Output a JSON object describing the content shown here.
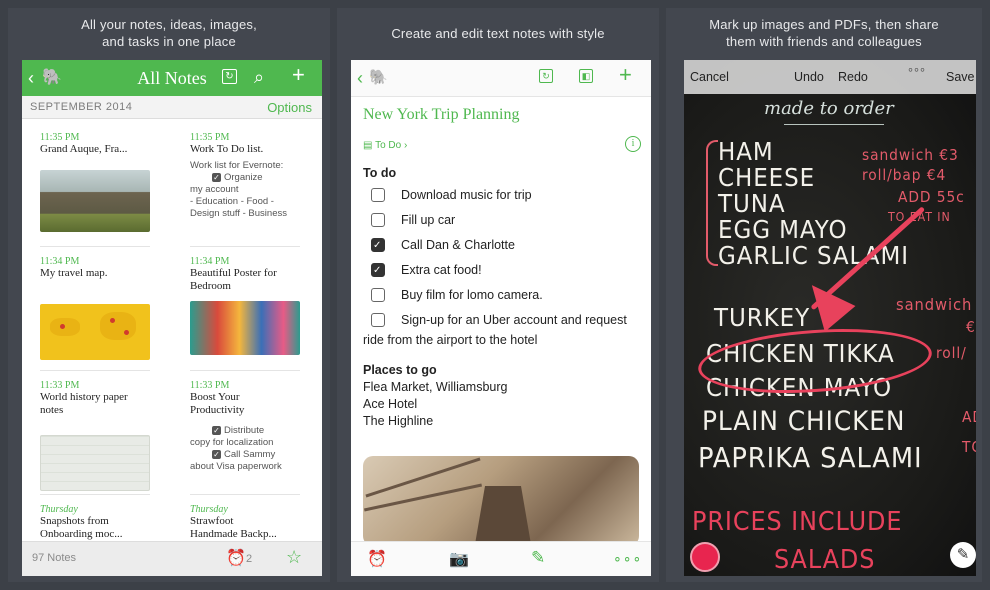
{
  "captions": {
    "p1": "All your notes, ideas, images,\nand tasks in one place",
    "p2": "Create and edit text notes with style",
    "p3": "Mark up images and PDFs, then share\nthem with friends and colleagues"
  },
  "panel1": {
    "title": "All Notes",
    "month": "SEPTEMBER 2014",
    "options": "Options",
    "count": "97 Notes",
    "reminder_count": "2",
    "notes": [
      {
        "time": "11:35 PM",
        "title": "Grand Auque, Fra..."
      },
      {
        "time": "11:35 PM",
        "title": "Work To Do list.",
        "text1": "Work list for Evernote:",
        "text2": "Organize",
        "text3": "my account",
        "text4": "- Education - Food -",
        "text5": "Design stuff - Business"
      },
      {
        "time": "11:34 PM",
        "title": "My travel map."
      },
      {
        "time": "11:34 PM",
        "title": "Beautiful  Poster for",
        "title2": "Bedroom"
      },
      {
        "time": "11:33 PM",
        "title": "World history paper",
        "title2": "notes"
      },
      {
        "time": "11:33 PM",
        "title": "Boost Your",
        "title2": "Productivity",
        "text1": "Distribute",
        "text2": "copy for localization",
        "text3": "Call Sammy",
        "text4": "about Visa paperwork"
      },
      {
        "time": "Thursday",
        "title": "Snapshots from",
        "title2": "Onboarding moc..."
      },
      {
        "time": "Thursday",
        "title": "Strawfoot",
        "title2": "Handmade Backp..."
      }
    ]
  },
  "panel2": {
    "note_title": "New York Trip Planning",
    "tag": "To Do",
    "todo_heading": "To do",
    "todos": [
      {
        "label": "Download music for trip",
        "done": false
      },
      {
        "label": "Fill up car",
        "done": false
      },
      {
        "label": "Call Dan & Charlotte",
        "done": true
      },
      {
        "label": "Extra cat food!",
        "done": true
      },
      {
        "label": "Buy film for lomo camera.",
        "done": false
      },
      {
        "label": "Sign-up for an Uber account and request",
        "done": false
      }
    ],
    "todo_wrap": "ride from the airport to the hotel",
    "places_heading": "Places to go",
    "places": [
      "Flea Market, Williamsburg",
      "Ace Hotel",
      "The Highline"
    ]
  },
  "panel3": {
    "cancel": "Cancel",
    "undo": "Undo",
    "redo": "Redo",
    "more": "°°°",
    "save": "Save",
    "board_header": "made to order",
    "menu1": [
      "HAM",
      "CHEESE",
      "TUNA",
      "EGG MAYO",
      "GARLIC SALAMI"
    ],
    "menu2": [
      "TURKEY",
      "CHICKEN TIKKA",
      "CHICKEN MAYO",
      "PLAIN CHICKEN",
      "PAPRIKA SALAMI"
    ],
    "side1": [
      "sandwich €3",
      "roll/bap €4",
      "ADD 55c",
      "TO EAT IN"
    ],
    "side2": [
      "sandwich",
      "€",
      "roll/",
      "AD",
      "TO"
    ],
    "footer": "PRICES INCLUDE",
    "footer2": "SALADS"
  }
}
